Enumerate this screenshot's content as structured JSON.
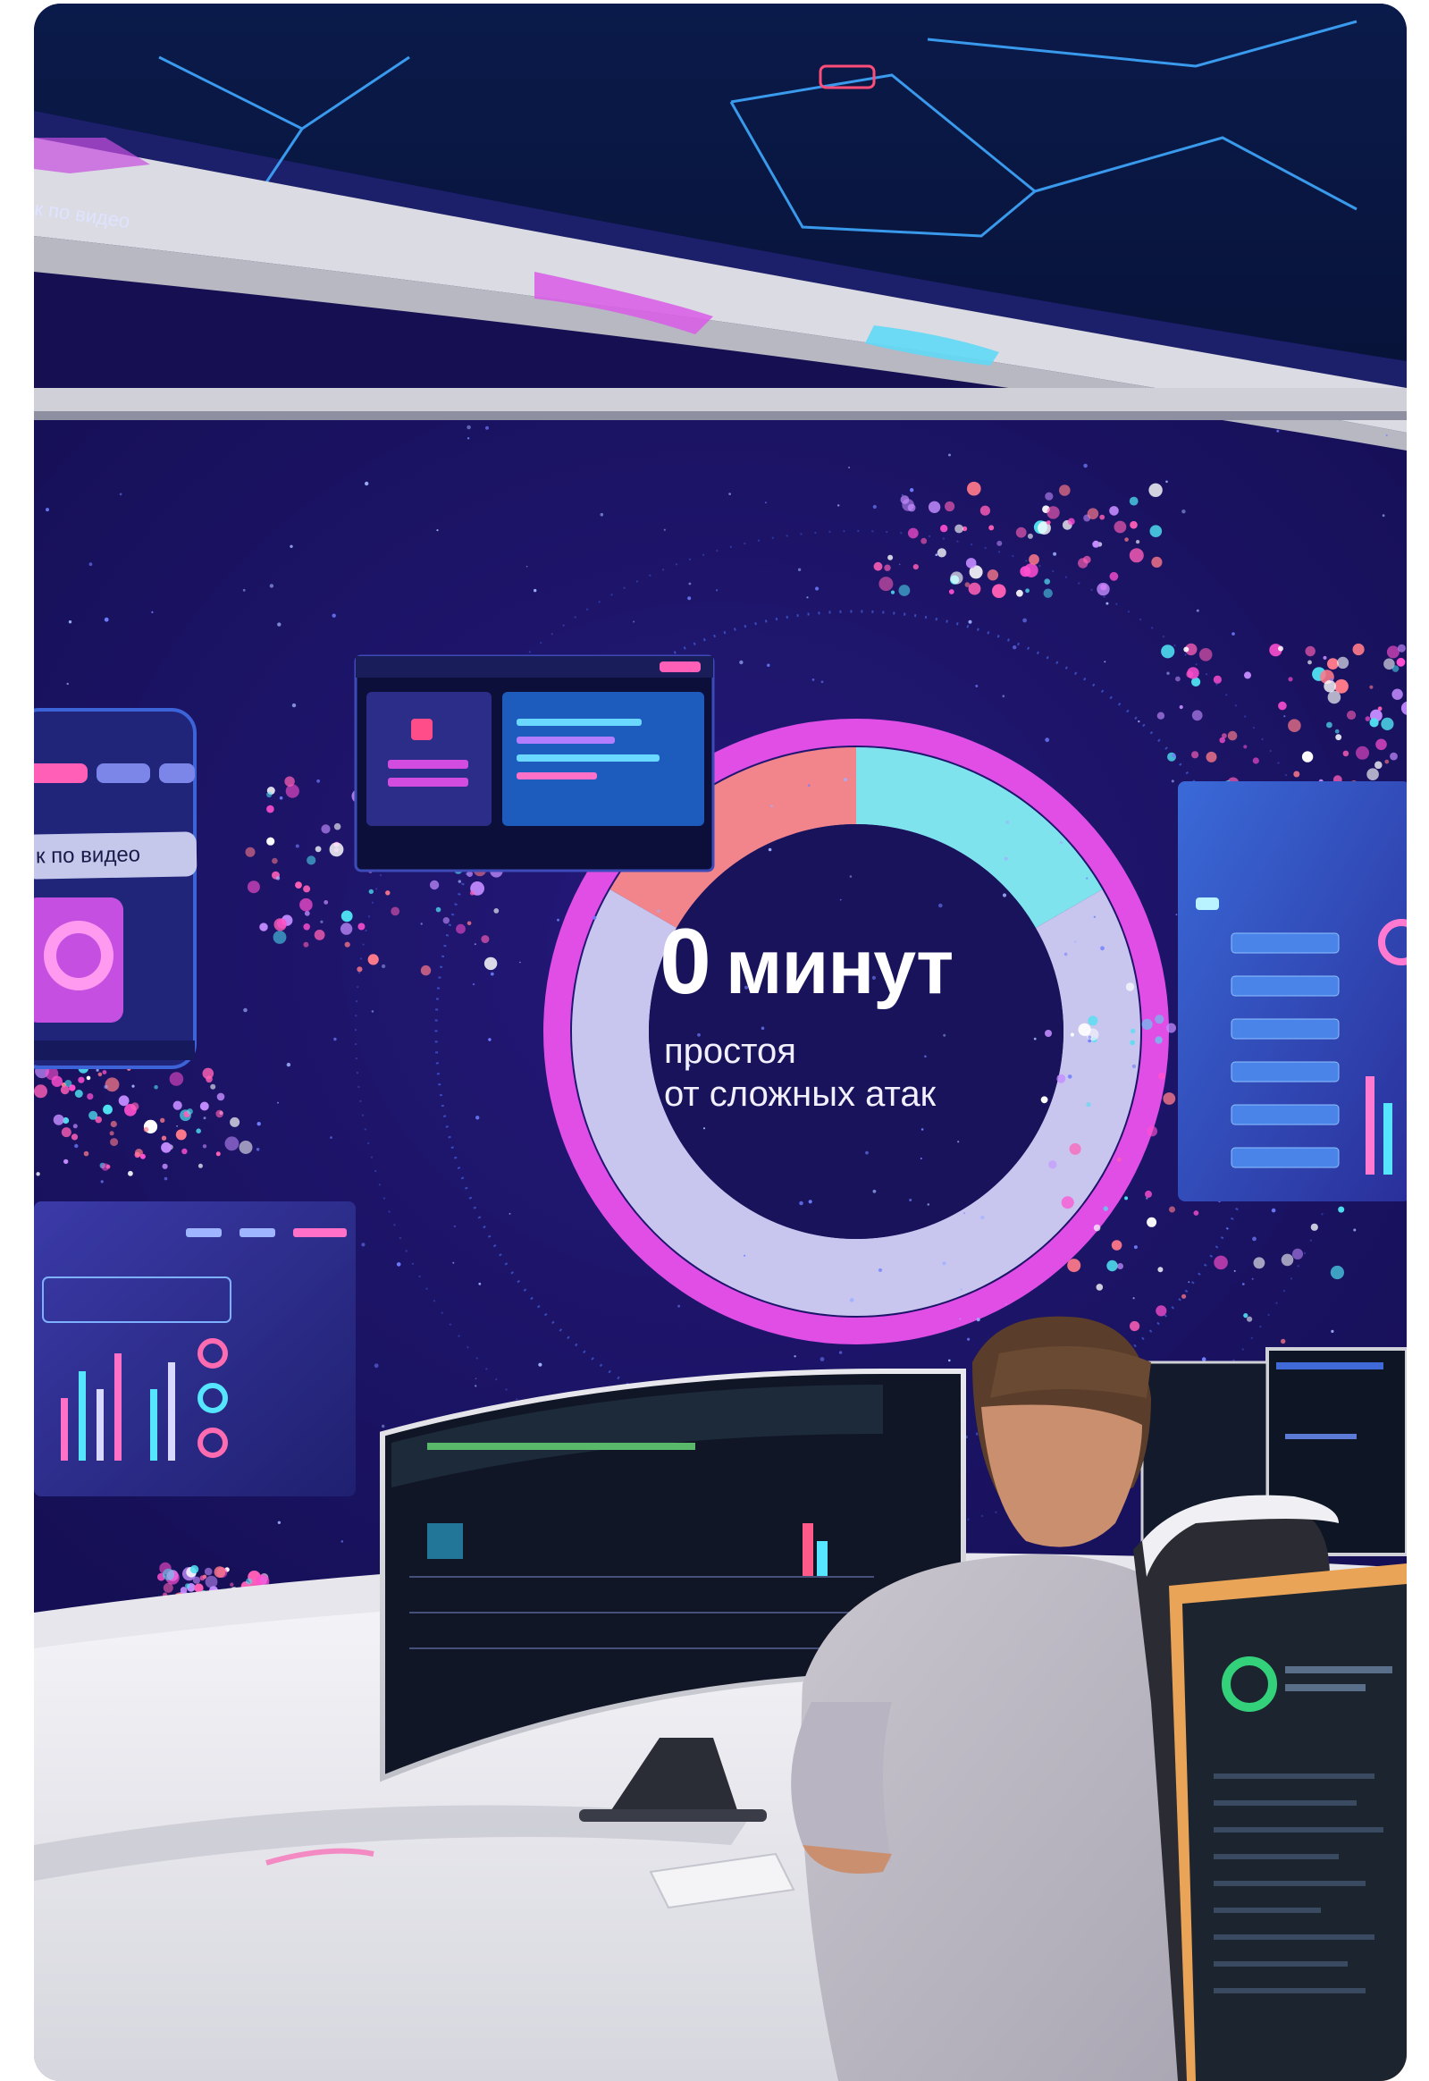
{
  "photo": {
    "alt": "Оператор за рабочим местом перед видеостеной ситуационного центра",
    "wall_headline": {
      "value": "0",
      "unit": "минут",
      "caption_line1": "простоя",
      "caption_line2": "от сложных атак"
    },
    "left_screen_label": "к по видео",
    "ceiling_label": "к по видео",
    "colors": {
      "wall_background": "#1d1668",
      "ring_magenta": "#e14ee6",
      "ring_lavender": "#c8c6ef",
      "ring_cyan": "#7fe3ee",
      "ring_coral": "#f2848c",
      "core_navy": "#18135a",
      "accent_pink": "#ff5fb6",
      "accent_cyan": "#4fe0f0"
    },
    "progress_ring": {
      "segments": [
        {
          "color": "#f2848c",
          "from_deg": 300,
          "to_deg": 360
        },
        {
          "color": "#7fe3ee",
          "from_deg": 0,
          "to_deg": 60
        },
        {
          "color": "#c8c6ef",
          "from_deg": 60,
          "to_deg": 300
        }
      ]
    }
  }
}
